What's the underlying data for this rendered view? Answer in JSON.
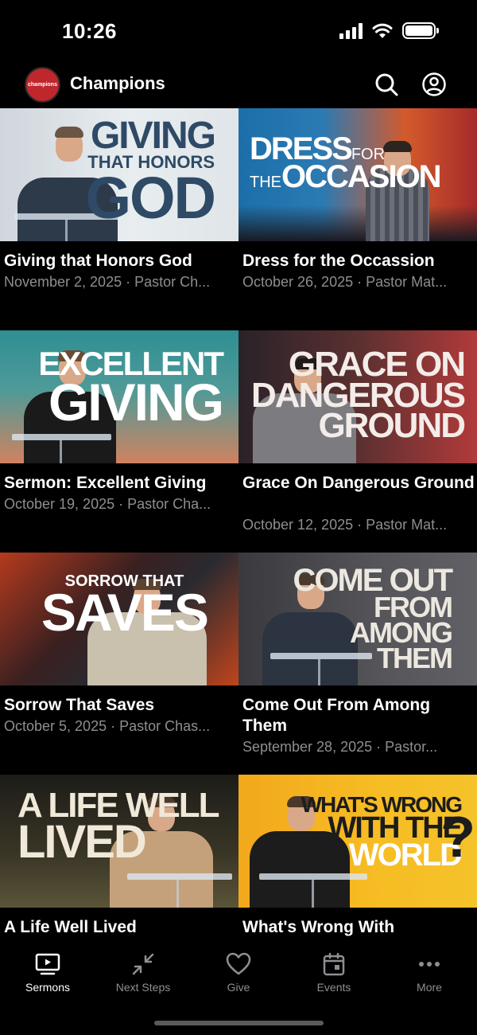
{
  "status": {
    "time": "10:26"
  },
  "header": {
    "logo_text": "champions",
    "title": "Champions",
    "search_icon": "search-icon",
    "account_icon": "account-icon"
  },
  "sermons": [
    {
      "title": "Giving that Honors God",
      "meta": "November 2, 2025 · Pastor Ch...",
      "art": [
        "GIVING",
        "THAT HONORS",
        "GOD"
      ]
    },
    {
      "title": "Dress for the Occassion",
      "meta": "October 26, 2025 · Pastor Mat...",
      "art": [
        "DRESS",
        "FOR",
        "THE",
        "OCCASION"
      ]
    },
    {
      "title": "Sermon: Excellent Giving",
      "meta": "October 19, 2025 · Pastor Cha...",
      "art": [
        "EXCELLENT",
        "GIVING"
      ]
    },
    {
      "title": "Grace On Dangerous Ground",
      "meta": "October 12, 2025 · Pastor Mat...",
      "art": [
        "GRACE ON",
        "DANGEROUS",
        "GROUND"
      ]
    },
    {
      "title": "Sorrow That Saves",
      "meta": "October 5, 2025 · Pastor Chas...",
      "art": [
        "SORROW THAT",
        "SAVES"
      ]
    },
    {
      "title": "Come Out From Among Them",
      "meta": "September 28, 2025 · Pastor...",
      "art": [
        "COME OUT",
        "FROM",
        "AMONG",
        "THEM"
      ]
    },
    {
      "title": "A Life Well Lived",
      "meta": "",
      "art": [
        "A LIFE WELL",
        "LIVED"
      ]
    },
    {
      "title": "What's Wrong With",
      "meta": "",
      "art": [
        "WHAT'S WRONG",
        "WITH THE",
        "WORLD",
        "?"
      ]
    }
  ],
  "tabs": [
    {
      "label": "Sermons",
      "icon": "tv-icon",
      "active": true
    },
    {
      "label": "Next Steps",
      "icon": "collapse-arrows-icon",
      "active": false
    },
    {
      "label": "Give",
      "icon": "heart-icon",
      "active": false
    },
    {
      "label": "Events",
      "icon": "calendar-icon",
      "active": false
    },
    {
      "label": "More",
      "icon": "ellipsis-icon",
      "active": false
    }
  ],
  "colors": {
    "background": "#000000",
    "meta_text": "#8e8e93",
    "logo_red": "#c0272d"
  }
}
